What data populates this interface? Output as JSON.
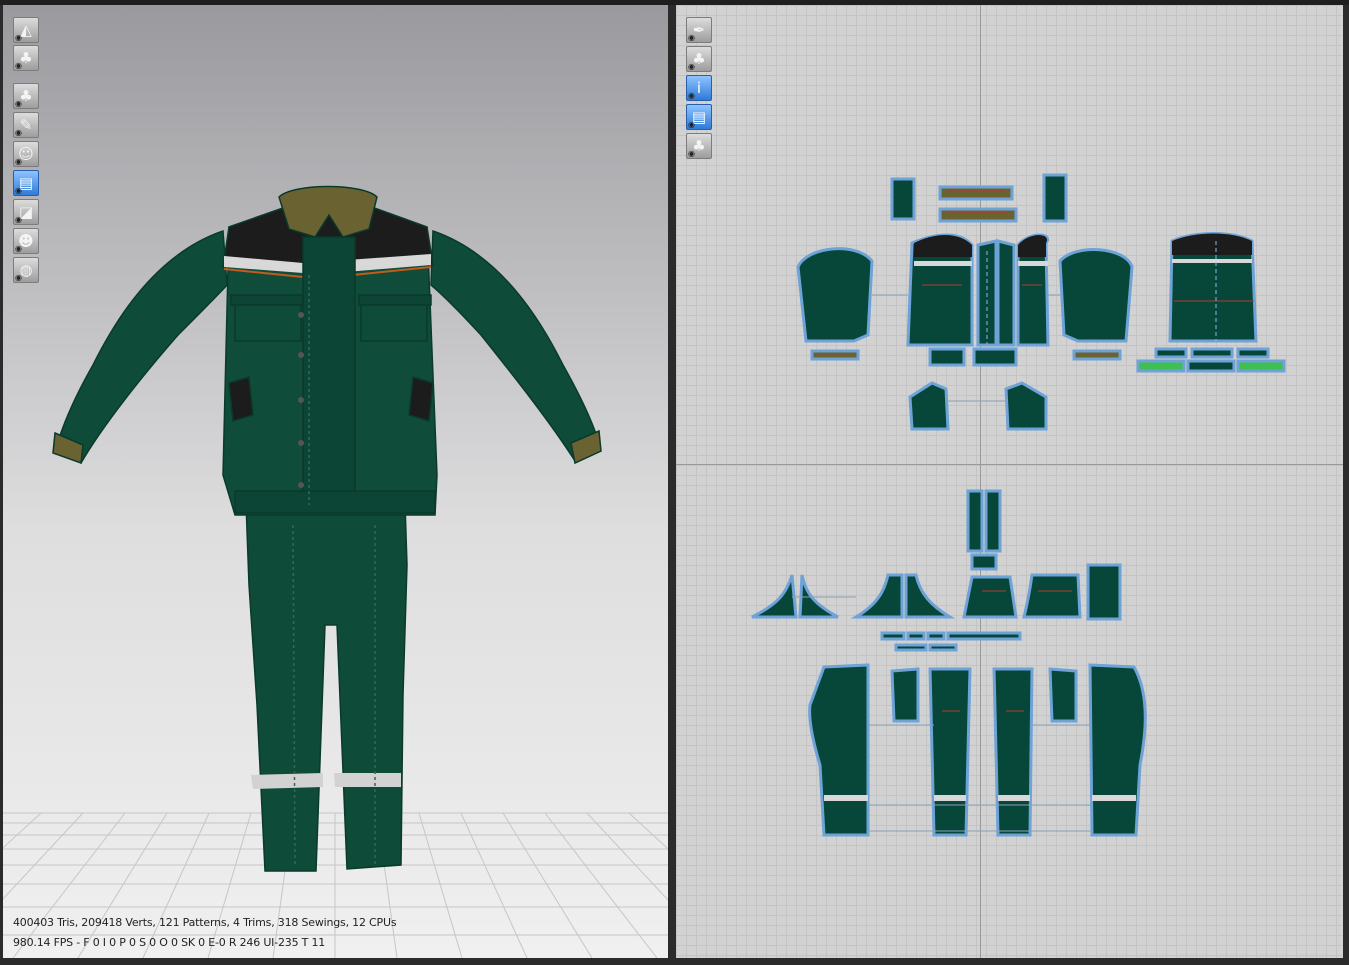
{
  "viewport3d": {
    "toolbar": [
      {
        "icon": "avatar-display-icon",
        "glyph": "◭",
        "active": false
      },
      {
        "icon": "garment-display-icon",
        "glyph": "♣",
        "active": false
      },
      {
        "icon": "show-garment-icon",
        "glyph": "♣",
        "active": false
      },
      {
        "icon": "show-sewing-icon",
        "glyph": "✎",
        "active": false
      },
      {
        "icon": "show-avatar-icon",
        "glyph": "☺",
        "active": false
      },
      {
        "icon": "texture-mode-icon",
        "glyph": "▤",
        "active": true
      },
      {
        "icon": "stress-map-icon",
        "glyph": "◪",
        "active": false
      },
      {
        "icon": "avatar-skin-icon",
        "glyph": "☻",
        "active": false
      },
      {
        "icon": "wireframe-globe-icon",
        "glyph": "◍",
        "active": false
      }
    ],
    "stats_line1": "400403 Tris, 209418 Verts, 121 Patterns, 4 Trims, 318 Sewings, 12 CPUs",
    "stats_line2": "980.14 FPS - F 0 I 0 P 0 S 0 O 0 SK 0 E-0 R 246 UI-235 T 11",
    "colors": {
      "garment": "#0d4a38",
      "collar": "#6b6231",
      "yoke": "#1c1c1c",
      "reflective": "#d8d8d8"
    }
  },
  "viewport2d": {
    "toolbar": [
      {
        "icon": "pen-tool-icon",
        "glyph": "✒",
        "active": false
      },
      {
        "icon": "show-pattern-icon",
        "glyph": "♣",
        "active": false
      },
      {
        "icon": "pattern-info-icon",
        "glyph": "i",
        "active": true
      },
      {
        "icon": "texture-display-icon",
        "glyph": "▤",
        "active": true
      },
      {
        "icon": "lock-pattern-icon",
        "glyph": "♣",
        "active": false
      }
    ],
    "colors": {
      "pattern": "#07473a",
      "outline": "#6ea3d8",
      "stitch": "#b33a2a"
    }
  }
}
